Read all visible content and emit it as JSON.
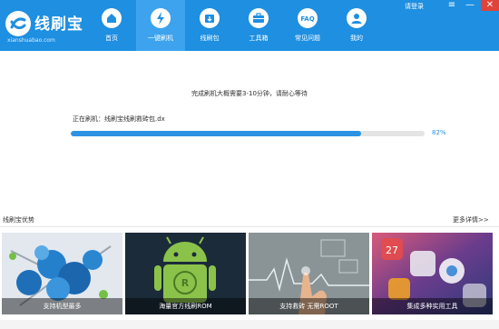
{
  "app": {
    "name": "线刷宝",
    "subtitle": "xianshuabao.com"
  },
  "nav": {
    "items": [
      {
        "label": "首页",
        "icon": "home-icon"
      },
      {
        "label": "一键刷机",
        "icon": "lightning-icon"
      },
      {
        "label": "线刷包",
        "icon": "package-download-icon"
      },
      {
        "label": "工具箱",
        "icon": "toolbox-icon"
      },
      {
        "label": "常见问题",
        "icon": "faq-icon"
      },
      {
        "label": "我的",
        "icon": "user-icon"
      }
    ],
    "active_index": 1
  },
  "window": {
    "login_label": "请登录",
    "menu_glyph": "≡",
    "minimize_glyph": "—",
    "close_glyph": "✕"
  },
  "flash": {
    "status_text": "完成刷机大概需要3-10分钟，请耐心等待",
    "current_label": "正在刷机：线刷宝线刷救砖包.dx",
    "progress_percent": 82,
    "progress_text": "82%"
  },
  "features": {
    "title": "线刷宝优势",
    "more_label": "更多详情>>",
    "cards": [
      {
        "caption": "支持机型最多"
      },
      {
        "caption": "海量官方线刷ROM"
      },
      {
        "caption": "支持救砖 无需ROOT"
      },
      {
        "caption": "集成多种实用工具"
      }
    ]
  },
  "colors": {
    "header": "#1e8fe1",
    "active_tab": "#3da3ee",
    "progress": "#2b92e4",
    "close": "#e0433a"
  }
}
